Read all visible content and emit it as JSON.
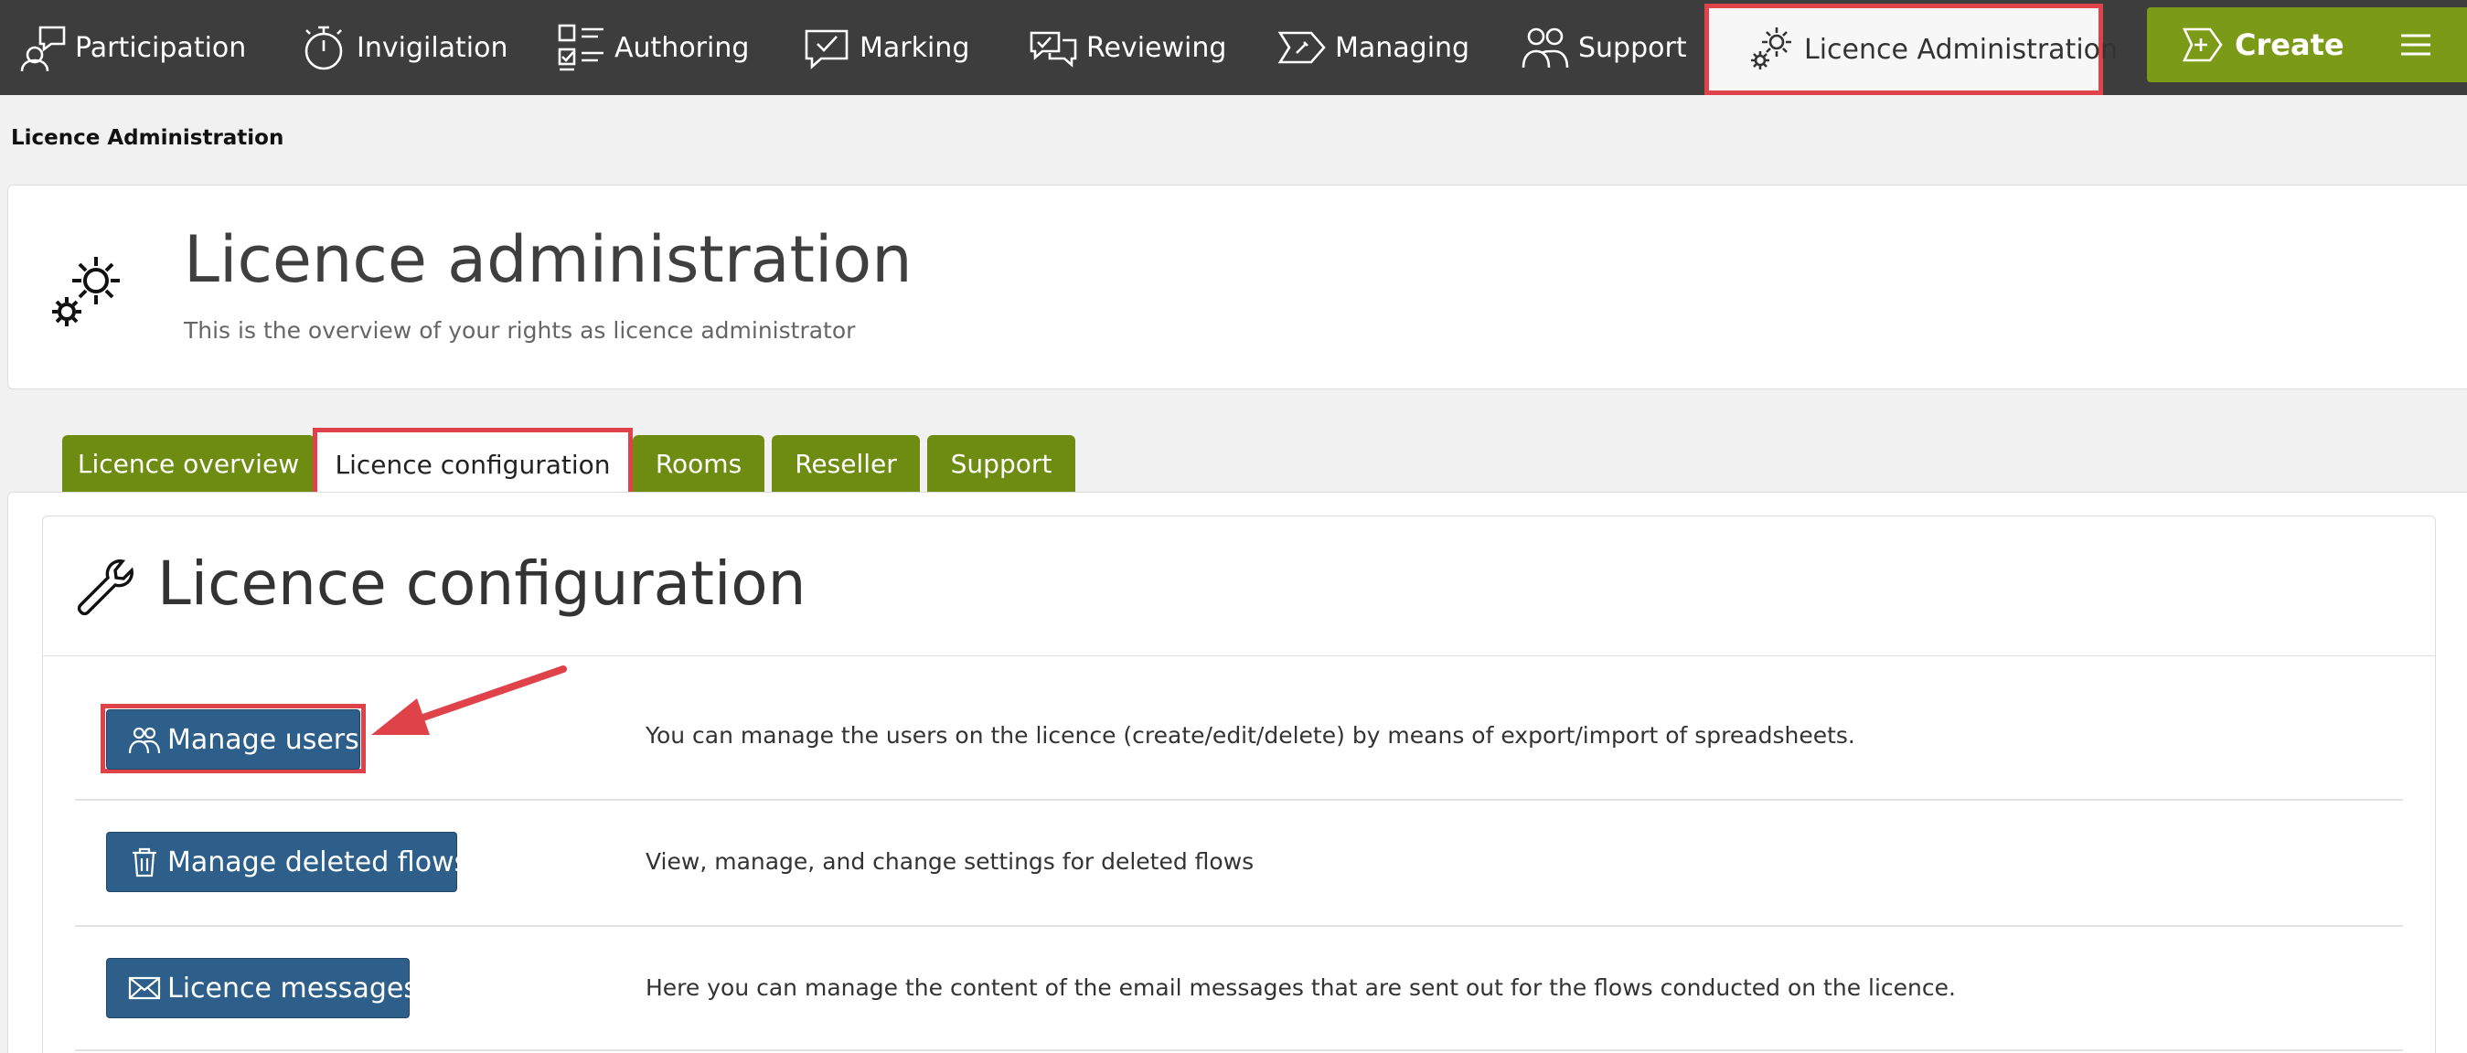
{
  "nav": {
    "items": [
      {
        "label": "Participation",
        "icon": "participation-icon"
      },
      {
        "label": "Invigilation",
        "icon": "stopwatch-icon"
      },
      {
        "label": "Authoring",
        "icon": "checklist-icon"
      },
      {
        "label": "Marking",
        "icon": "marking-bubble-icon"
      },
      {
        "label": "Reviewing",
        "icon": "reviewing-bubbles-icon"
      },
      {
        "label": "Managing",
        "icon": "managing-icon"
      },
      {
        "label": "Support",
        "icon": "support-people-icon"
      },
      {
        "label": "Licence Administration",
        "icon": "gears-icon"
      }
    ],
    "create_label": "Create",
    "create_icon": "create-plus-icon",
    "menu_icon": "hamburger-menu-icon"
  },
  "breadcrumb": "Licence Administration",
  "header": {
    "title": "Licence administration",
    "subtitle": "This is the overview of your rights as licence administrator",
    "icon": "gears-icon"
  },
  "tabs": [
    {
      "label": "Licence overview"
    },
    {
      "label": "Licence configuration"
    },
    {
      "label": "Rooms"
    },
    {
      "label": "Reseller"
    },
    {
      "label": "Support"
    }
  ],
  "config": {
    "title": "Licence configuration",
    "icon": "wrench-icon",
    "rows": [
      {
        "button": "Manage users",
        "icon": "users-icon",
        "description": "You can manage the users on the licence (create/edit/delete) by means of export/import of spreadsheets."
      },
      {
        "button": "Manage deleted flows",
        "icon": "trash-icon",
        "description": "View, manage, and change settings for deleted flows"
      },
      {
        "button": "Licence messages",
        "icon": "envelope-icon",
        "description": "Here you can manage the content of the email messages that are sent out for the flows conducted on the licence."
      }
    ]
  },
  "colors": {
    "nav_bg": "#3d3d3d",
    "accent_green": "#6f8c12",
    "create_green": "#7a9a18",
    "button_blue": "#2d5f8a",
    "highlight_red": "#e0424a"
  }
}
